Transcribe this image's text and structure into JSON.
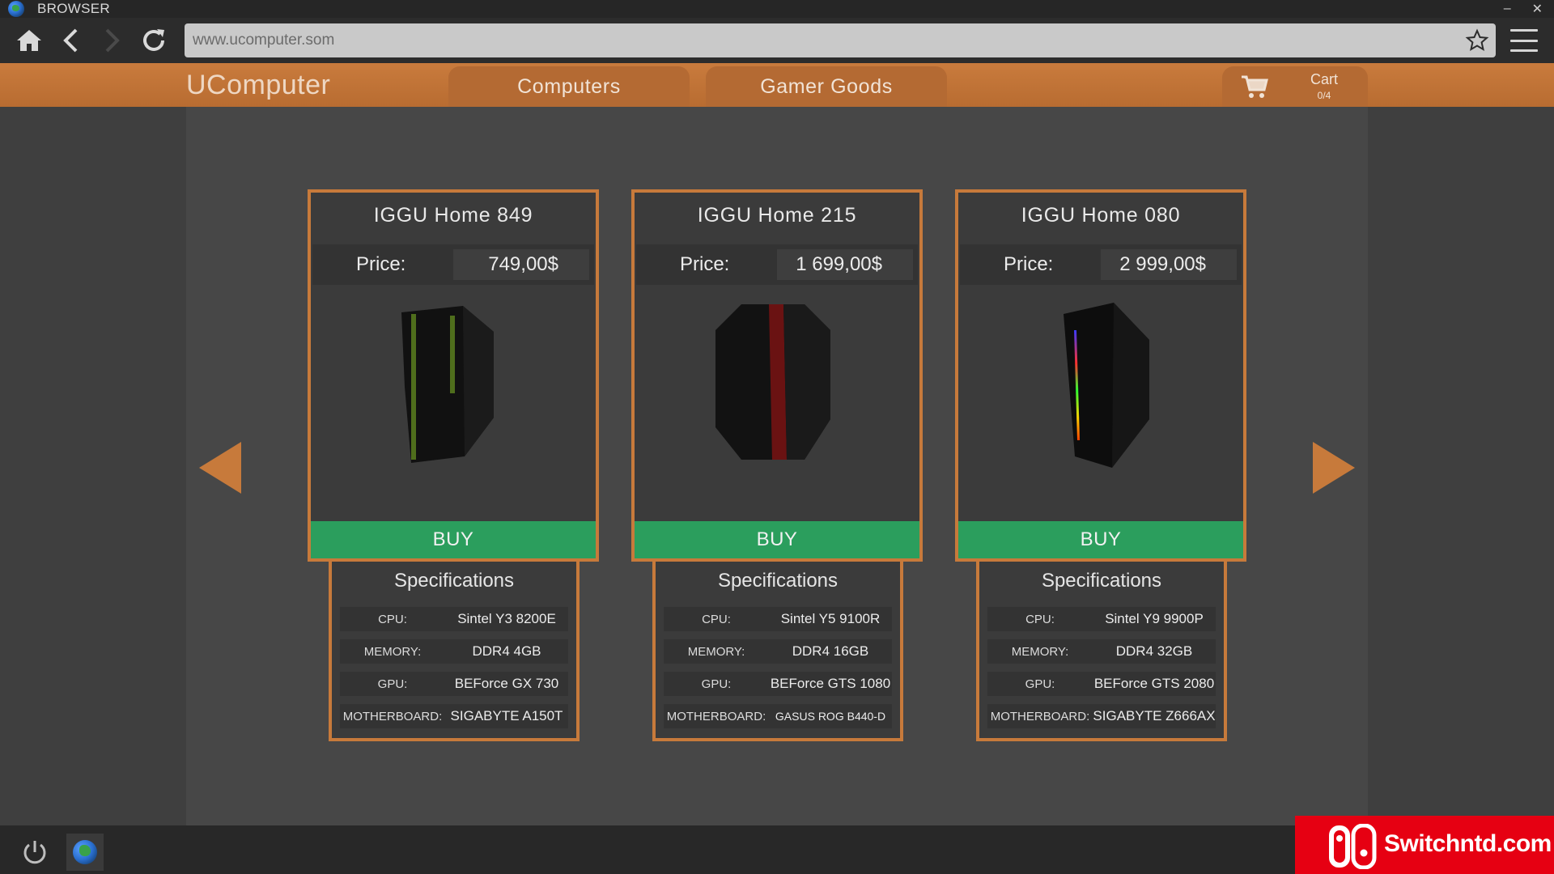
{
  "window": {
    "title": "BROWSER",
    "minimize": "–",
    "close": "✕"
  },
  "browser": {
    "url": "www.ucomputer.som"
  },
  "site": {
    "logo": "UComputer",
    "tabs": [
      {
        "label": "Computers"
      },
      {
        "label": "Gamer Goods"
      }
    ],
    "cart": {
      "label": "Cart",
      "count": "0/4"
    }
  },
  "products": [
    {
      "name": "IGGU Home 849",
      "price_label": "Price:",
      "price": "749,00$",
      "accent_color": "#4f6e1c",
      "buy_label": "BUY",
      "specs_title": "Specifications",
      "specs": [
        {
          "key": "CPU:",
          "value": "Sintel Y3 8200E"
        },
        {
          "key": "MEMORY:",
          "value": "DDR4 4GB"
        },
        {
          "key": "GPU:",
          "value": "BEForce GX 730"
        },
        {
          "key": "MOTHERBOARD:",
          "value": "SIGABYTE A150T"
        }
      ]
    },
    {
      "name": "IGGU Home 215",
      "price_label": "Price:",
      "price": "1 699,00$",
      "accent_color": "#6a1212",
      "buy_label": "BUY",
      "specs_title": "Specifications",
      "specs": [
        {
          "key": "CPU:",
          "value": "Sintel Y5 9100R"
        },
        {
          "key": "MEMORY:",
          "value": "DDR4 16GB"
        },
        {
          "key": "GPU:",
          "value": "BEForce GTS 1080"
        },
        {
          "key": "MOTHERBOARD:",
          "value": "GASUS ROG B440-D"
        }
      ]
    },
    {
      "name": "IGGU Home 080",
      "price_label": "Price:",
      "price": "2 999,00$",
      "accent_color": "rainbow",
      "buy_label": "BUY",
      "specs_title": "Specifications",
      "specs": [
        {
          "key": "CPU:",
          "value": "Sintel Y9 9900P"
        },
        {
          "key": "MEMORY:",
          "value": "DDR4 32GB"
        },
        {
          "key": "GPU:",
          "value": "BEForce GTS 2080"
        },
        {
          "key": "MOTHERBOARD:",
          "value": "SIGABYTE Z666AX"
        }
      ]
    }
  ],
  "watermark": {
    "text": "Switchntd.com"
  },
  "colors": {
    "accent": "#c77a3b",
    "buy": "#2b9e5d",
    "header": "#c07434",
    "watermark": "#e60012"
  },
  "icons": [
    "home-icon",
    "back-icon",
    "forward-icon",
    "reload-icon",
    "star-icon",
    "menu-icon",
    "cart-icon",
    "arrow-left-icon",
    "arrow-right-icon",
    "power-icon",
    "globe-icon"
  ]
}
